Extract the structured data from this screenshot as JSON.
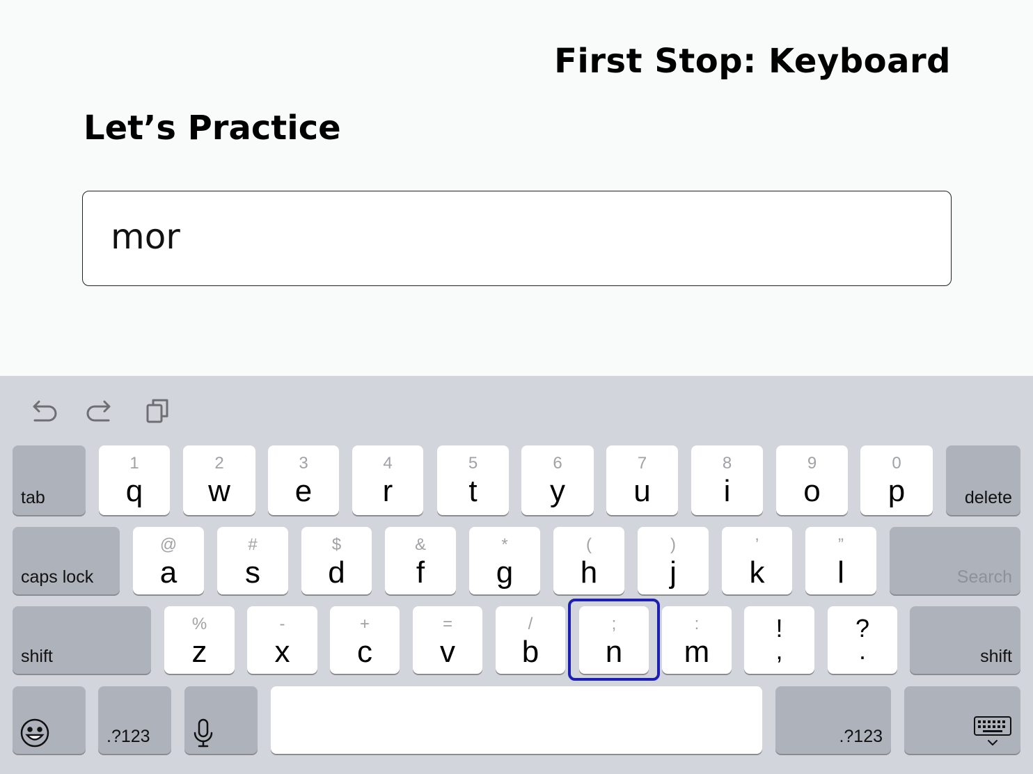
{
  "header": {
    "page_title": "First Stop: Keyboard",
    "section_title": "Let’s Practice"
  },
  "input": {
    "value": "mor"
  },
  "keyboard": {
    "toolbar": {
      "undo_icon": "undo-icon",
      "redo_icon": "redo-icon",
      "clipboard_icon": "clipboard-icon"
    },
    "row1": [
      {
        "hint": "1",
        "key": "q"
      },
      {
        "hint": "2",
        "key": "w"
      },
      {
        "hint": "3",
        "key": "e"
      },
      {
        "hint": "4",
        "key": "r"
      },
      {
        "hint": "5",
        "key": "t"
      },
      {
        "hint": "6",
        "key": "y"
      },
      {
        "hint": "7",
        "key": "u"
      },
      {
        "hint": "8",
        "key": "i"
      },
      {
        "hint": "9",
        "key": "o"
      },
      {
        "hint": "0",
        "key": "p"
      }
    ],
    "row2": [
      {
        "hint": "@",
        "key": "a"
      },
      {
        "hint": "#",
        "key": "s"
      },
      {
        "hint": "$",
        "key": "d"
      },
      {
        "hint": "&",
        "key": "f"
      },
      {
        "hint": "*",
        "key": "g"
      },
      {
        "hint": "(",
        "key": "h"
      },
      {
        "hint": ")",
        "key": "j"
      },
      {
        "hint": "’",
        "key": "k"
      },
      {
        "hint": "”",
        "key": "l"
      }
    ],
    "row3": [
      {
        "hint": "%",
        "key": "z"
      },
      {
        "hint": "-",
        "key": "x"
      },
      {
        "hint": "+",
        "key": "c"
      },
      {
        "hint": "=",
        "key": "v"
      },
      {
        "hint": "/",
        "key": "b"
      },
      {
        "hint": ";",
        "key": "n"
      },
      {
        "hint": ":",
        "key": "m"
      }
    ],
    "punct": [
      {
        "top": "!",
        "bottom": ","
      },
      {
        "top": "?",
        "bottom": "."
      }
    ],
    "labels": {
      "tab": "tab",
      "delete": "delete",
      "caps_lock": "caps lock",
      "search": "Search",
      "shift_left": "shift",
      "shift_right": "shift",
      "numbers_left": ".?123",
      "numbers_right": ".?123"
    },
    "icons": {
      "emoji": "emoji-icon",
      "mic": "microphone-icon",
      "hide_keyboard": "hide-keyboard-icon"
    },
    "highlighted_key": "n"
  }
}
